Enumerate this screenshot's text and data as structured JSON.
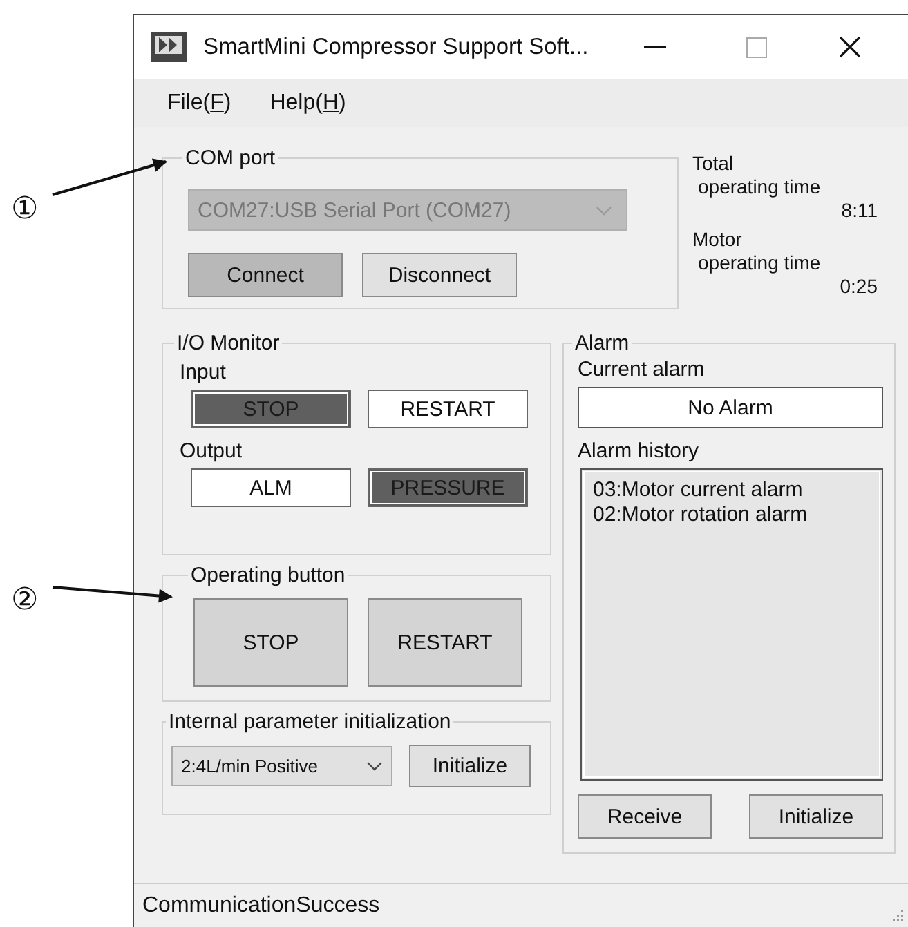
{
  "callouts": [
    {
      "label": "①"
    },
    {
      "label": "②"
    }
  ],
  "window": {
    "title": "SmartMini Compressor Support Soft..."
  },
  "menu": [
    {
      "before": "File(",
      "key": "F",
      "after": ")"
    },
    {
      "before": "Help(",
      "key": "H",
      "after": ")"
    }
  ],
  "com_port": {
    "label": "COM port",
    "port": "COM27:USB Serial Port (COM27)",
    "buttons": [
      {
        "label": "Connect",
        "disabled": true
      },
      {
        "label": "Disconnect",
        "disabled": false
      }
    ]
  },
  "times": [
    {
      "label": "Total",
      "sub": "operating time",
      "value": "8:11"
    },
    {
      "label": "Motor",
      "sub": "operating time",
      "value": "0:25"
    }
  ],
  "io_monitor": {
    "label": "I/O Monitor",
    "groups": [
      {
        "label": "Input",
        "indicators": [
          {
            "label": "STOP",
            "on": true
          },
          {
            "label": "RESTART",
            "on": false
          }
        ]
      },
      {
        "label": "Output",
        "indicators": [
          {
            "label": "ALM",
            "on": false
          },
          {
            "label": "PRESSURE",
            "on": true
          }
        ]
      }
    ]
  },
  "operating_button": {
    "label": "Operating button",
    "buttons": [
      "STOP",
      "RESTART"
    ]
  },
  "internal_init": {
    "label": "Internal parameter initialization",
    "selection": "2:4L/min Positive",
    "button": "Initialize"
  },
  "alarm": {
    "label": "Alarm",
    "current_label": "Current alarm",
    "current": "No Alarm",
    "history_label": "Alarm history",
    "history": [
      "03:Motor current alarm",
      "02:Motor rotation alarm"
    ],
    "buttons": [
      "Receive",
      "Initialize"
    ]
  },
  "status_bar": "CommunicationSuccess"
}
